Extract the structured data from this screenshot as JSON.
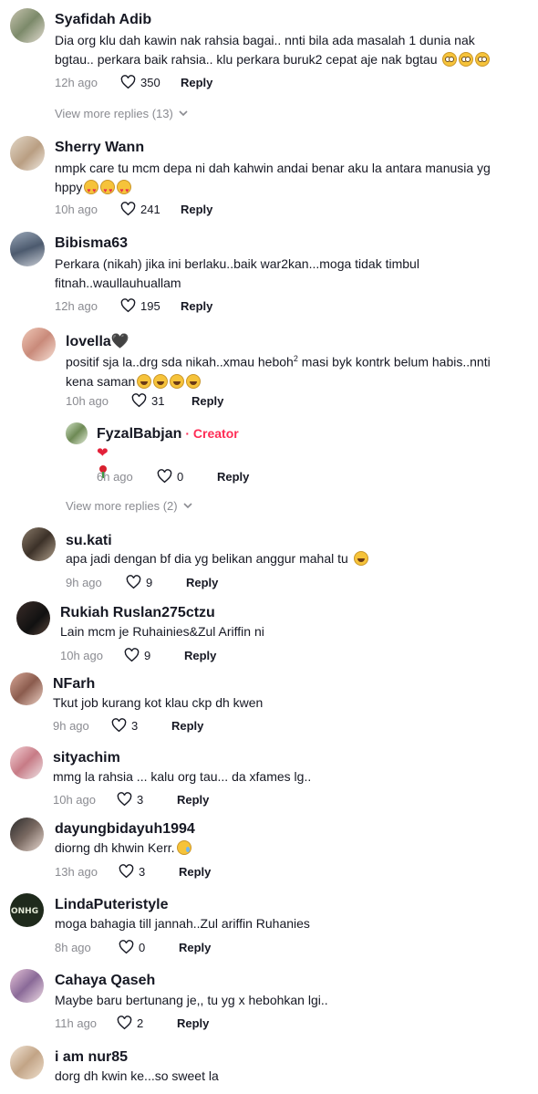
{
  "labels": {
    "reply": "Reply",
    "creator_badge": "· Creator"
  },
  "colors": {
    "accent": "#fe2c55",
    "muted": "#8a8b91",
    "text": "#161823"
  },
  "comments": [
    {
      "username": "Syafidah Adib",
      "text1": "Dia org klu dah kawin nak rahsia bagai.. nnti bila ada masalah 1 dunia nak",
      "text2": "bgtau.. perkara baik rahsia.. klu perkara buruk2 cepat aje nak bgtau",
      "emojis": [
        "face-with-rolling-eyes",
        "face-with-rolling-eyes",
        "face-with-rolling-eyes"
      ],
      "time": "12h ago",
      "likes": "350",
      "more_replies": "View more replies (13)"
    },
    {
      "username": "Sherry Wann",
      "text1": "nmpk care tu mcm depa ni dah kahwin andai benar aku la antara manusia yg",
      "text2": "hppy",
      "emojis": [
        "smiling-face-with-hearts",
        "smiling-face-with-hearts",
        "smiling-face-with-hearts"
      ],
      "time": "10h ago",
      "likes": "241"
    },
    {
      "username": "Bibisma63",
      "text1": "Perkara (nikah) jika ini berlaku..baik war2kan...moga tidak timbul",
      "text2": "fitnah..waullauhuallam",
      "time": "12h ago",
      "likes": "195"
    },
    {
      "username": "lovella🖤",
      "text1_a": "positif sja la..drg sda nikah..xmau heboh",
      "text1_sup": "2",
      "text1_b": " masi byk kontrk belum habis..nnti",
      "text2": "kena saman",
      "emojis": [
        "grinning-squinting-face",
        "grinning-squinting-face",
        "grinning-squinting-face",
        "grinning-squinting-face"
      ],
      "time": "10h ago",
      "likes": "31"
    },
    {
      "username": "FyzalBabjan",
      "emojis": [
        "red-heart",
        "rose"
      ],
      "time": "6h ago",
      "likes": "0",
      "more_replies": "View more replies (2)"
    },
    {
      "username": "su.kati",
      "text1": "apa jadi dengan bf dia yg belikan anggur mahal tu",
      "emojis": [
        "grinning-squinting-face"
      ],
      "time": "9h ago",
      "likes": "9"
    },
    {
      "username": "Rukiah Ruslan275ctzu",
      "text1": "Lain mcm je Ruhainies&Zul Ariffin ni",
      "time": "10h ago",
      "likes": "9"
    },
    {
      "username": "NFarh",
      "text1": "Tkut job kurang kot klau ckp dh kwen",
      "time": "9h ago",
      "likes": "3"
    },
    {
      "username": "sityachim",
      "text1": "mmg la rahsia ... kalu org tau... da xfames lg..",
      "time": "10h ago",
      "likes": "3"
    },
    {
      "username": "dayungbidayuh1994",
      "text1": "diorng dh khwin Kerr.",
      "emojis": [
        "sad-but-relieved-face"
      ],
      "time": "13h ago",
      "likes": "3"
    },
    {
      "username": "LindaPuteristyle",
      "text1": "moga bahagia till jannah..Zul ariffin Ruhanies",
      "time": "8h ago",
      "likes": "0"
    },
    {
      "username": "Cahaya Qaseh",
      "text1": "Maybe baru bertunang je,, tu yg x hebohkan lgi..",
      "time": "11h ago",
      "likes": "2"
    },
    {
      "username": "i am nur85",
      "text1": "dorg dh kwin ke...so sweet la"
    }
  ]
}
